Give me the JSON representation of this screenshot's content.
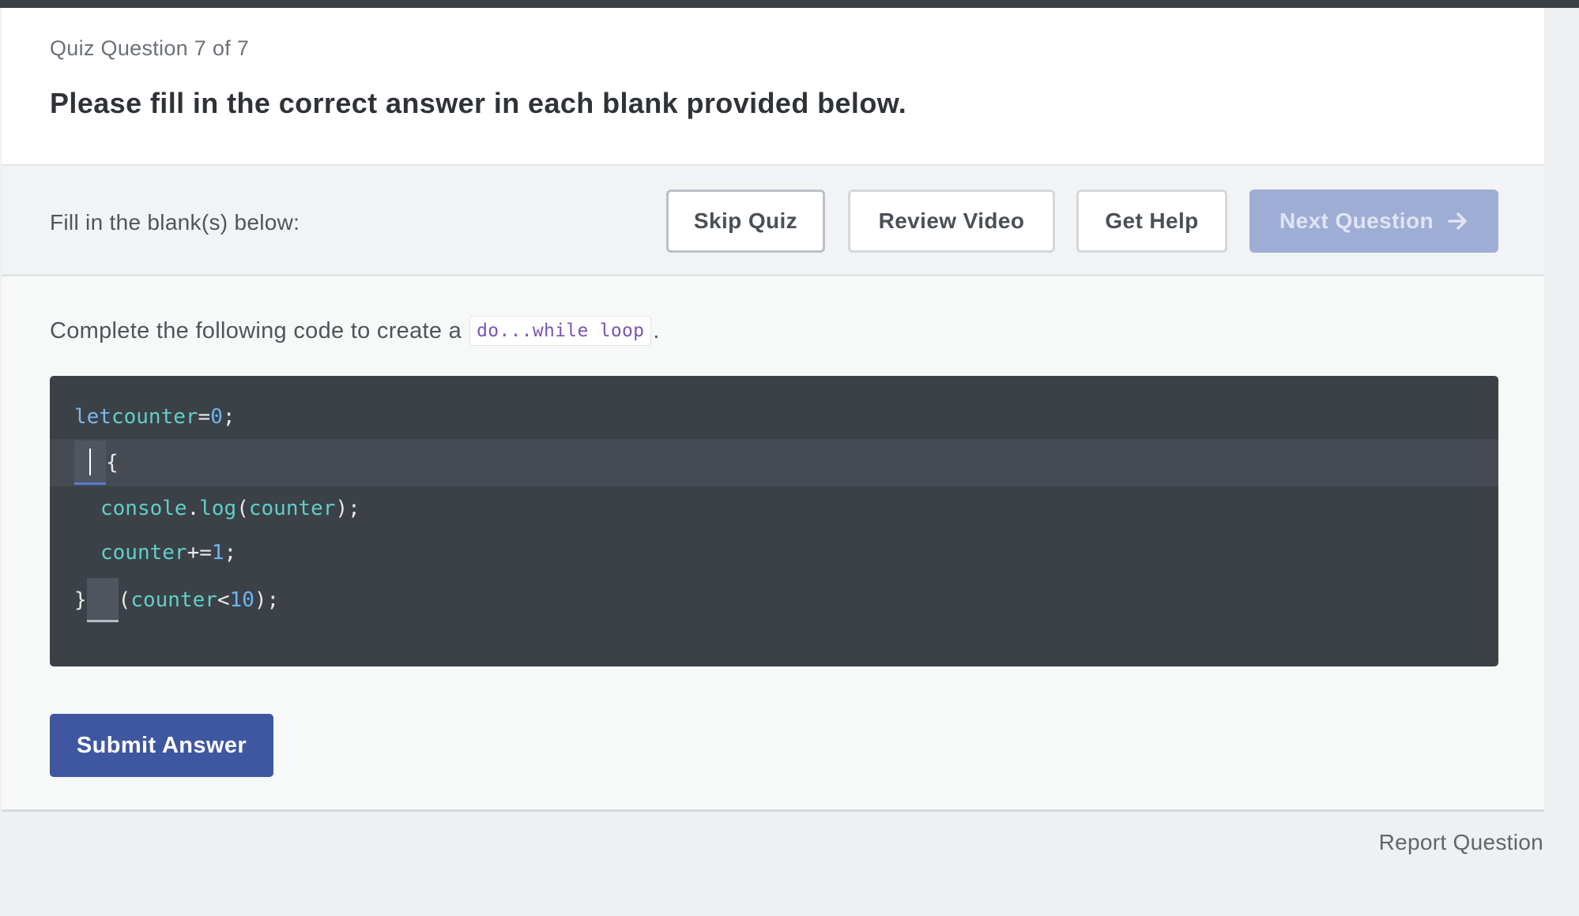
{
  "header": {
    "counter": "Quiz Question 7 of 7",
    "title": "Please fill in the correct answer in each blank provided below."
  },
  "toolbar": {
    "label": "Fill in the blank(s) below:",
    "skip_label": "Skip Quiz",
    "review_label": "Review Video",
    "help_label": "Get Help",
    "next_label": "Next Question",
    "next_icon": "arrow-right-icon"
  },
  "prompt": {
    "text": "Complete the following code to create a",
    "code": "do...while loop",
    "suffix": "."
  },
  "code": {
    "line1": {
      "keyword": "let",
      "ident": "counter",
      "op": "=",
      "num": "0",
      "end": ";"
    },
    "line2": {
      "brace": "{",
      "blank_value": ""
    },
    "line3": {
      "obj": "console",
      "dot": ".",
      "method": "log",
      "open": "(",
      "arg": "counter",
      "close": ");"
    },
    "line4": {
      "ident": "counter",
      "op": "+=",
      "num": "1",
      "end": ";"
    },
    "line5": {
      "brace": "}",
      "blank_value": "",
      "open": "(",
      "ident": "counter",
      "op": "<",
      "num": "10",
      "close": ");"
    }
  },
  "actions": {
    "submit_label": "Submit Answer",
    "report_label": "Report Question"
  },
  "colors": {
    "primary": "#3e57a0",
    "primary_disabled": "#9eadd4",
    "editor_bg": "#3c4047"
  }
}
